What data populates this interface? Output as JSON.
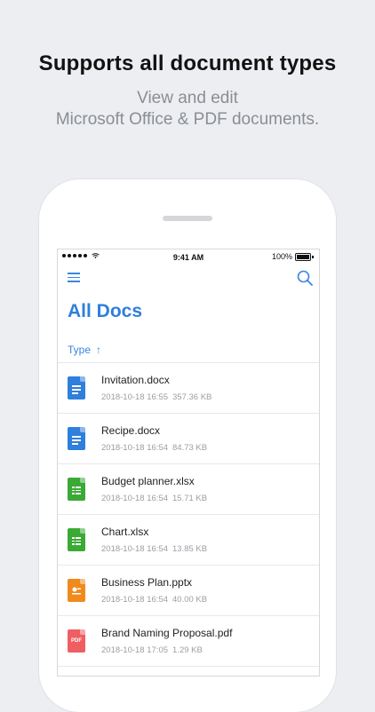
{
  "promo": {
    "headline": "Supports all document types",
    "subline1": "View and edit",
    "subline2": "Microsoft Office & PDF documents."
  },
  "status_bar": {
    "time": "9:41 AM",
    "battery": "100%"
  },
  "app": {
    "title": "All Docs",
    "sort_label": "Type",
    "sort_arrow": "↑",
    "accent_color": "#2f7fdc"
  },
  "files": [
    {
      "name": "Invitation.docx",
      "date": "2018-10-18 16:55",
      "size": "357.36 KB",
      "type": "docx",
      "icon": "word-doc-icon",
      "color": "#2f7fdc"
    },
    {
      "name": "Recipe.docx",
      "date": "2018-10-18 16:54",
      "size": "84.73 KB",
      "type": "docx",
      "icon": "word-doc-icon",
      "color": "#2f7fdc"
    },
    {
      "name": "Budget planner.xlsx",
      "date": "2018-10-18 16:54",
      "size": "15.71 KB",
      "type": "xlsx",
      "icon": "spreadsheet-icon",
      "color": "#3aaa35"
    },
    {
      "name": "Chart.xlsx",
      "date": "2018-10-18 16:54",
      "size": "13.85 KB",
      "type": "xlsx",
      "icon": "spreadsheet-icon",
      "color": "#3aaa35"
    },
    {
      "name": "Business Plan.pptx",
      "date": "2018-10-18 16:54",
      "size": "40.00 KB",
      "type": "pptx",
      "icon": "presentation-icon",
      "color": "#f08a1c"
    },
    {
      "name": "Brand Naming Proposal.pdf",
      "date": "2018-10-18 17:05",
      "size": "1.29 KB",
      "type": "pdf",
      "icon": "pdf-icon",
      "color": "#ef5e63",
      "badge": "PDF"
    }
  ]
}
